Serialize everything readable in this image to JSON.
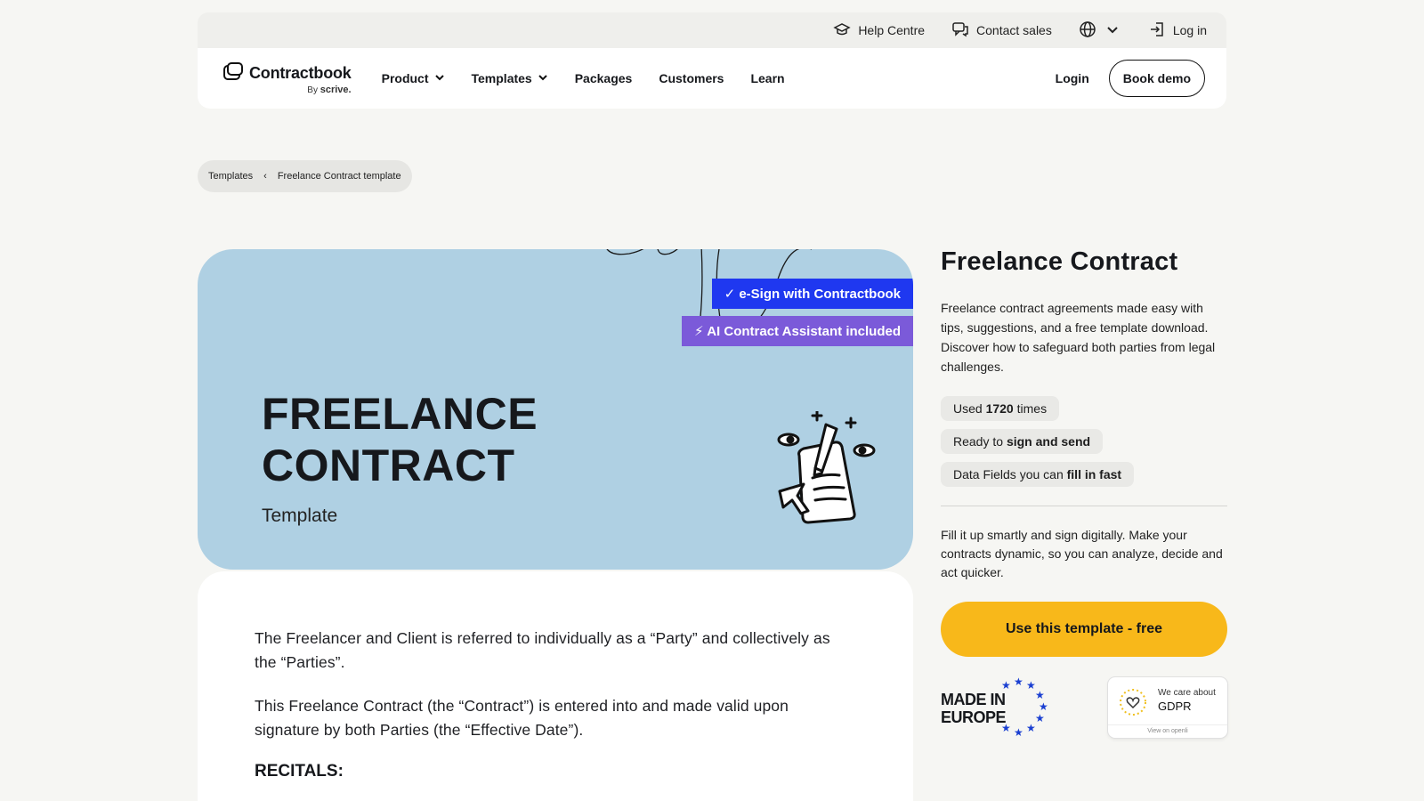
{
  "utility": {
    "help": "Help Centre",
    "contact": "Contact sales",
    "login": "Log in"
  },
  "nav": {
    "logo_name": "Contractbook",
    "logo_by": "By",
    "logo_scrive": "scrive.",
    "links": [
      "Product",
      "Templates",
      "Packages",
      "Customers",
      "Learn"
    ],
    "login": "Login",
    "book_demo": "Book demo"
  },
  "breadcrumb": {
    "parent": "Templates",
    "separator": "‹",
    "current": "Freelance Contract template"
  },
  "hero": {
    "title_line1": "FREELANCE",
    "title_line2": "CONTRACT",
    "subtitle": "Template",
    "badge_esign": "✓ e-Sign with Contractbook",
    "badge_ai": "⚡ AI Contract Assistant included"
  },
  "content": {
    "p1": "The Freelancer and Client is referred to individually as a “Party” and collectively as the “Parties”.",
    "p2": "This Freelance Contract (the “Contract”) is entered into and made valid upon signature by both Parties (the “Effective Date”).",
    "recitals": "RECITALS:"
  },
  "panel": {
    "title": "Freelance Contract",
    "description": "Freelance contract agreements made easy with tips, suggestions, and a free template download. Discover how to safeguard both parties from legal challenges.",
    "chip1_pre": "Used",
    "chip1_bold": "1720",
    "chip1_post": "times",
    "chip2_pre": "Ready to",
    "chip2_bold": "sign and send",
    "chip3_pre": "Data Fields you can",
    "chip3_bold": "fill in fast",
    "description2": "Fill it up smartly and sign digitally. Make your contracts dynamic, so you can analyze, decide and act quicker.",
    "cta": "Use this template - free",
    "made_line1": "MADE IN",
    "made_line2": "EUROPE",
    "gdpr_top": "We care about",
    "gdpr_main": "GDPR",
    "gdpr_foot": "View on openli"
  },
  "colors": {
    "hero_bg": "#afd0e3",
    "badge_esign": "#1f38f0",
    "badge_ai": "#7b5ad9",
    "cta": "#f8b81a",
    "page_bg": "#f6f6f3"
  }
}
